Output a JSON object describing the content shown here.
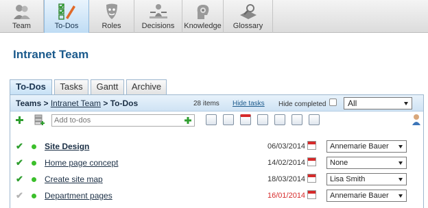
{
  "nav": [
    {
      "label": "Team",
      "icon": "team-icon"
    },
    {
      "label": "To-Dos",
      "icon": "todos-icon"
    },
    {
      "label": "Roles",
      "icon": "roles-icon"
    },
    {
      "label": "Decisions",
      "icon": "decisions-icon"
    },
    {
      "label": "Knowledge",
      "icon": "knowledge-icon"
    },
    {
      "label": "Glossary",
      "icon": "glossary-icon"
    }
  ],
  "page_title": "Intranet Team",
  "tabs": [
    "To-Dos",
    "Tasks",
    "Gantt",
    "Archive"
  ],
  "breadcrumb": {
    "root": "Teams",
    "sep": ">",
    "team": "Intranet Team",
    "current": "To-Dos"
  },
  "items_count": "28 items",
  "hide_tasks": "Hide tasks",
  "hide_completed": "Hide completed",
  "filter_value": "All",
  "add_placeholder": "Add to-dos",
  "colors": {
    "accent": "#1b5a8c",
    "overdue": "#d62a2a",
    "done": "#2f9e2f"
  },
  "todos": [
    {
      "name": "Site Design",
      "bold": true,
      "date": "06/03/2014",
      "overdue": false,
      "assignee": "Annemarie Bauer",
      "done": true
    },
    {
      "name": "Home page concept",
      "bold": false,
      "date": "14/02/2014",
      "overdue": false,
      "assignee": "None",
      "done": true
    },
    {
      "name": "Create site map",
      "bold": false,
      "date": "18/03/2014",
      "overdue": false,
      "assignee": "Lisa Smith",
      "done": true
    },
    {
      "name": "Department pages",
      "bold": false,
      "date": "16/01/2014",
      "overdue": true,
      "assignee": "Annemarie Bauer",
      "done": false
    }
  ]
}
